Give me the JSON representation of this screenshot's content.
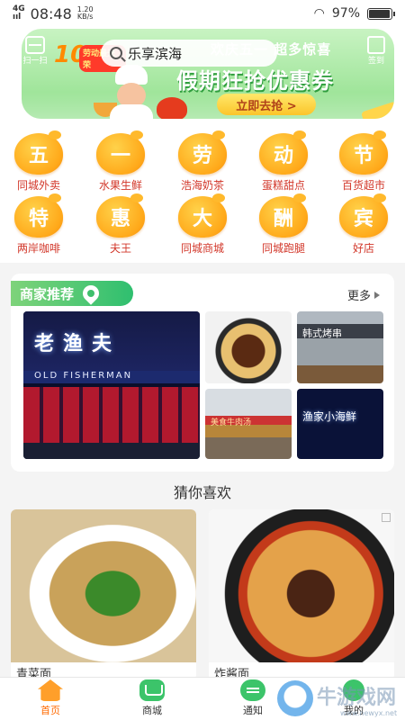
{
  "status_bar": {
    "network": "4G",
    "network_sub": "ııl",
    "time": "08:48",
    "speed": "1.20",
    "speed_unit": "KB/s",
    "battery": "97%"
  },
  "header": {
    "scan_label": "扫一扫",
    "search_text": "乐享滨海",
    "checkin_label": "签到",
    "promo_number": "10",
    "promo_tag": "劳动最光荣"
  },
  "banner": {
    "subtitle": "欢庆五一 超多惊喜",
    "title": "假期狂抢优惠券",
    "button_label": "立即去抢 >"
  },
  "categories": [
    {
      "char": "五",
      "label": "同城外卖"
    },
    {
      "char": "一",
      "label": "水果生鲜"
    },
    {
      "char": "劳",
      "label": "浩海奶茶"
    },
    {
      "char": "动",
      "label": "蛋糕甜点"
    },
    {
      "char": "节",
      "label": "百货超市"
    },
    {
      "char": "特",
      "label": "两岸咖啡"
    },
    {
      "char": "惠",
      "label": "夫王"
    },
    {
      "char": "大",
      "label": "同城商城"
    },
    {
      "char": "酬",
      "label": "同城跑腿"
    },
    {
      "char": "宾",
      "label": "好店"
    }
  ],
  "merchants": {
    "title": "商家推荐",
    "more_label": "更多",
    "photos": {
      "big_sign": "老渔夫",
      "big_sign_en": "OLD FISHERMAN",
      "korean_sign": "韩式烤串",
      "beef_sign": "美食牛肉汤",
      "fish_sign": "渔家小海鲜"
    }
  },
  "guess": {
    "title": "猜你喜欢",
    "items": [
      {
        "name": "青菜面"
      },
      {
        "name": "炸酱面"
      }
    ]
  },
  "bottom_nav": [
    {
      "label": "首页",
      "active": true
    },
    {
      "label": "商城",
      "active": false
    },
    {
      "label": "通知",
      "active": false
    },
    {
      "label": "我的",
      "active": false
    }
  ],
  "watermark": {
    "text": "牛游戏网",
    "url": "www.newyx.net"
  },
  "colors": {
    "banner_green": "#8fdf8a",
    "category_orange": "#ffa91a",
    "category_label_red": "#d2372a",
    "merchant_green": "#2fbf6f",
    "active_nav": "#ff6a00"
  }
}
